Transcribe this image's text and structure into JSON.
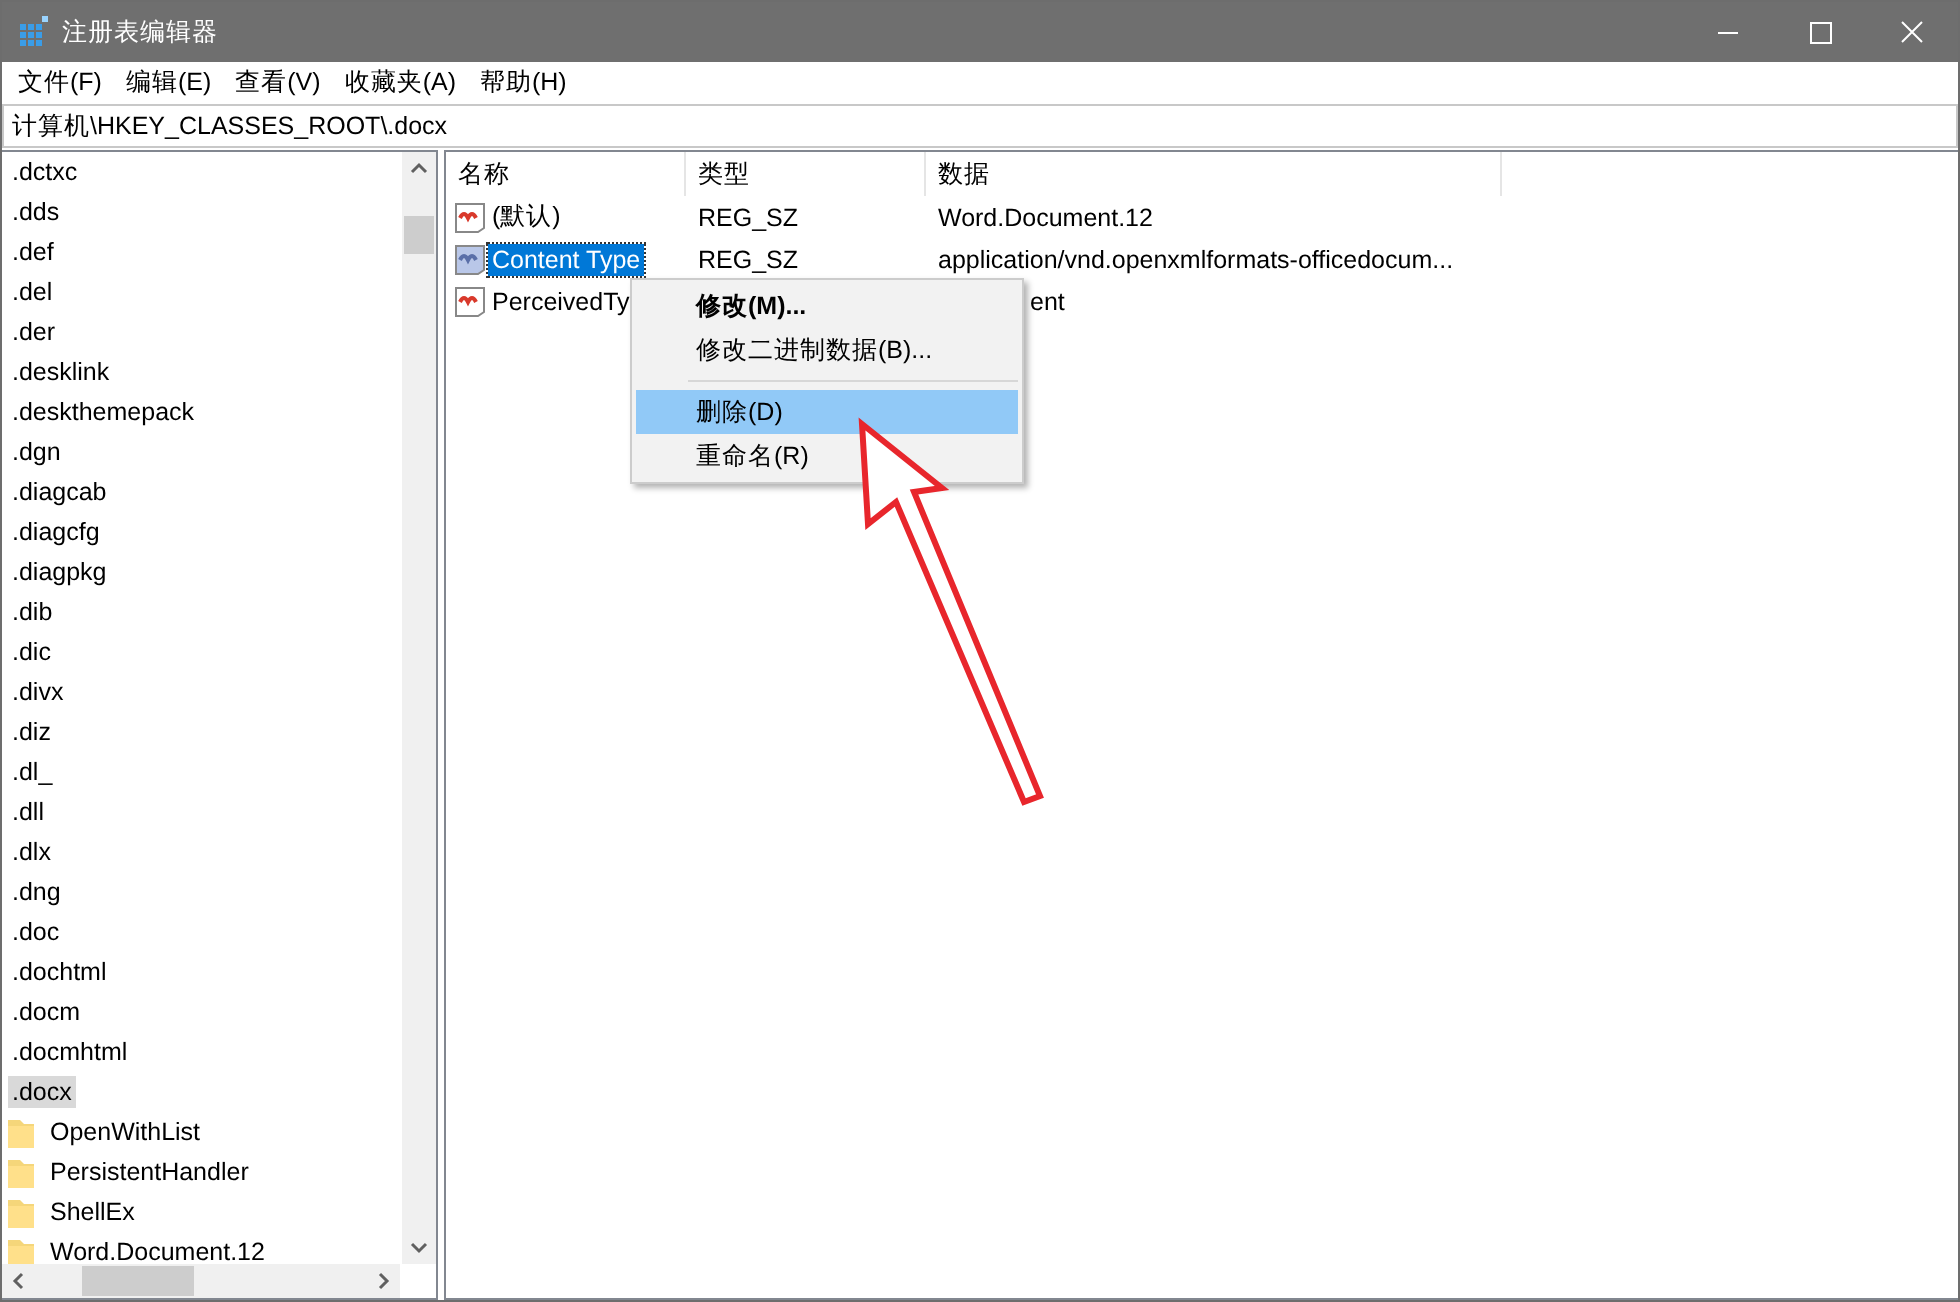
{
  "window": {
    "title": "注册表编辑器"
  },
  "menu": [
    "文件(F)",
    "编辑(E)",
    "查看(V)",
    "收藏夹(A)",
    "帮助(H)"
  ],
  "address": "计算机\\HKEY_CLASSES_ROOT\\.docx",
  "tree": [
    {
      "label": ".dctxc",
      "selected": false
    },
    {
      "label": ".dds",
      "selected": false
    },
    {
      "label": ".def",
      "selected": false
    },
    {
      "label": ".del",
      "selected": false
    },
    {
      "label": ".der",
      "selected": false
    },
    {
      "label": ".desklink",
      "selected": false
    },
    {
      "label": ".deskthemepack",
      "selected": false
    },
    {
      "label": ".dgn",
      "selected": false
    },
    {
      "label": ".diagcab",
      "selected": false
    },
    {
      "label": ".diagcfg",
      "selected": false
    },
    {
      "label": ".diagpkg",
      "selected": false
    },
    {
      "label": ".dib",
      "selected": false
    },
    {
      "label": ".dic",
      "selected": false
    },
    {
      "label": ".divx",
      "selected": false
    },
    {
      "label": ".diz",
      "selected": false
    },
    {
      "label": ".dl_",
      "selected": false
    },
    {
      "label": ".dll",
      "selected": false
    },
    {
      "label": ".dlx",
      "selected": false
    },
    {
      "label": ".dng",
      "selected": false
    },
    {
      "label": ".doc",
      "selected": false
    },
    {
      "label": ".dochtml",
      "selected": false
    },
    {
      "label": ".docm",
      "selected": false
    },
    {
      "label": ".docmhtml",
      "selected": false
    },
    {
      "label": ".docx",
      "selected": true,
      "children": [
        {
          "label": "OpenWithList",
          "selected": false
        },
        {
          "label": "PersistentHandler",
          "selected": false
        },
        {
          "label": "ShellEx",
          "selected": false
        },
        {
          "label": "Word.Document.12",
          "selected": false
        }
      ]
    }
  ],
  "values": {
    "columns": [
      "名称",
      "类型",
      "数据"
    ],
    "rows": [
      {
        "name": "(默认)",
        "type": "REG_SZ",
        "data": "Word.Document.12",
        "selected": false,
        "covered": false
      },
      {
        "name": "Content Type",
        "type": "REG_SZ",
        "data": "application/vnd.openxmlformats-officedocum...",
        "selected": true,
        "covered": false
      },
      {
        "name": "PerceivedTy",
        "data": "ent",
        "selected": false,
        "covered": true
      }
    ]
  },
  "context_menu": [
    {
      "label": "修改(M)...",
      "kind": "item",
      "bold": true,
      "selected": false
    },
    {
      "label": "修改二进制数据(B)...",
      "kind": "item",
      "bold": false,
      "selected": false
    },
    {
      "kind": "separator"
    },
    {
      "label": "删除(D)",
      "kind": "item",
      "bold": false,
      "selected": true
    },
    {
      "label": "重命名(R)",
      "kind": "item",
      "bold": false,
      "selected": false
    }
  ]
}
